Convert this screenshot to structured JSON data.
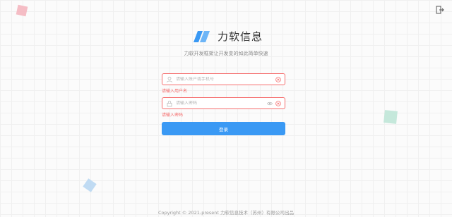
{
  "brand": {
    "title": "力软信息",
    "subtitle": "力软开发框架让开发变的如此简单快速"
  },
  "form": {
    "username_placeholder": "请输入账户或手机号",
    "username_error": "请输入用户名",
    "password_placeholder": "请输入密码",
    "password_error": "请输入密码",
    "login_label": "登录"
  },
  "footer": {
    "copyright": "Copyright © 2021-present 力软信息技术（苏州）有限公司出品"
  },
  "colors": {
    "primary": "#3a99f4",
    "error": "#f56c6c",
    "logo": "#3a99f4"
  },
  "icons": {
    "logout": "logout-icon",
    "user": "user-icon",
    "lock": "lock-icon",
    "clear": "clear-icon",
    "eye": "eye-icon"
  }
}
